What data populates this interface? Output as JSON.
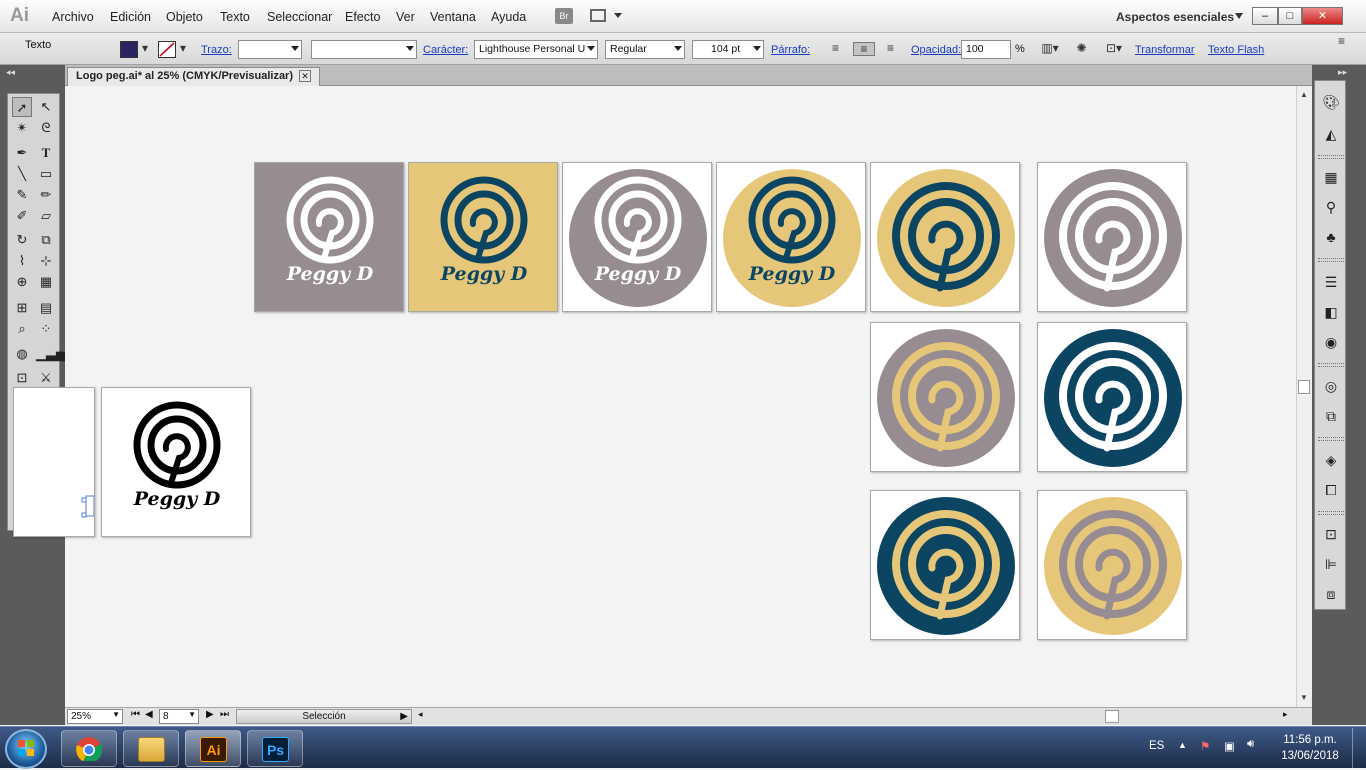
{
  "app": {
    "logo": "Ai"
  },
  "menu": [
    "Archivo",
    "Edición",
    "Objeto",
    "Texto",
    "Seleccionar",
    "Efecto",
    "Ver",
    "Ventana",
    "Ayuda"
  ],
  "bridge_label": "Br",
  "workspace": {
    "label": "Aspectos esenciales"
  },
  "window_controls": {
    "minimize": "–",
    "maximize": "□",
    "close": "✕"
  },
  "control_bar": {
    "selection_type": "Texto",
    "fill_color": "#2a2560",
    "stroke_label": "Trazo:",
    "character_label": "Carácter:",
    "font_family": "Lighthouse Personal U",
    "font_style": "Regular",
    "font_size": "104 pt",
    "paragraph_label": "Párrafo:",
    "opacity_label": "Opacidad:",
    "opacity_value": "100",
    "opacity_unit": "%",
    "transform_label": "Transformar",
    "flash_text_label": "Texto Flash"
  },
  "document": {
    "tab_title": "Logo peg.ai* al 25% (CMYK/Previsualizar)",
    "close": "✕"
  },
  "status_bar": {
    "zoom": "25%",
    "artboard_number": "8",
    "tool_status": "Selección"
  },
  "logo": {
    "text": "Peggy D"
  },
  "colors": {
    "mauve": "#968c92",
    "gold": "#e6c779",
    "teal": "#0b4562",
    "white": "#ffffff",
    "black": "#000000",
    "selection_blue": "#4f7fd1"
  },
  "artboards": [
    {
      "bg": "#968c92",
      "circle": null,
      "mark": "#ffffff",
      "text": true
    },
    {
      "bg": "#e6c779",
      "circle": null,
      "mark": "#0b4562",
      "text": true
    },
    {
      "bg": "#ffffff",
      "circle": "#968c92",
      "mark": "#ffffff",
      "text": true
    },
    {
      "bg": "#ffffff",
      "circle": "#e6c779",
      "mark": "#0b4562",
      "text": true
    },
    {
      "bg": "#ffffff",
      "circle": "#e6c779",
      "mark": "#0b4562",
      "text": false
    },
    {
      "bg": "#ffffff",
      "circle": "#968c92",
      "mark": "#ffffff",
      "text": false
    },
    {
      "bg": "#ffffff",
      "circle": "#968c92",
      "mark": "#e6c779",
      "text": false
    },
    {
      "bg": "#ffffff",
      "circle": "#0b4562",
      "mark": "#ffffff",
      "text": false
    },
    {
      "bg": "#ffffff",
      "circle": "#0b4562",
      "mark": "#e6c779",
      "text": false
    },
    {
      "bg": "#ffffff",
      "circle": "#e6c779",
      "mark": "#968c92",
      "text": false
    },
    {
      "bg": "#ffffff",
      "circle": null,
      "mark": "#000000",
      "text": true
    }
  ],
  "taskbar": {
    "apps": [
      {
        "name": "chrome",
        "label": ""
      },
      {
        "name": "explorer",
        "label": ""
      },
      {
        "name": "illustrator",
        "label": "Ai"
      },
      {
        "name": "photoshop",
        "label": "Ps"
      }
    ],
    "language": "ES",
    "time": "11:56 p.m.",
    "date": "13/06/2018"
  }
}
